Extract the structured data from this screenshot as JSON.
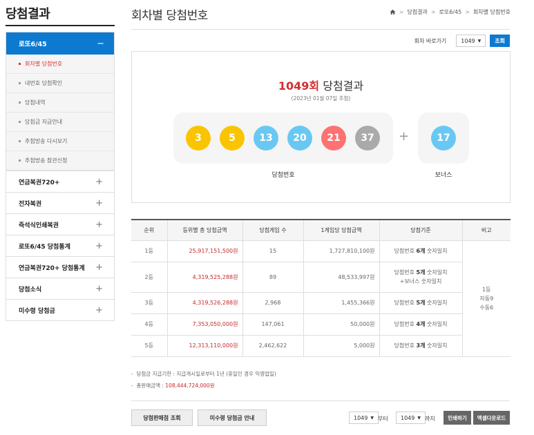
{
  "sidebar": {
    "title": "당첨결과",
    "active": {
      "label": "로또6/45",
      "symbol": "−"
    },
    "sub_items": [
      {
        "label": "회차별 당첨번호",
        "current": true
      },
      {
        "label": "내번호 당첨확인",
        "current": false
      },
      {
        "label": "당첨내역",
        "current": false
      },
      {
        "label": "당첨금 지급안내",
        "current": false
      },
      {
        "label": "추첨방송 다시보기",
        "current": false
      },
      {
        "label": "추첨방송 참관신청",
        "current": false
      }
    ],
    "items": [
      {
        "label": "연금복권720+",
        "symbol": "+"
      },
      {
        "label": "전자복권",
        "symbol": "+"
      },
      {
        "label": "즉석식인쇄복권",
        "symbol": "+"
      },
      {
        "label": "로또6/45 당첨통계",
        "symbol": "+"
      },
      {
        "label": "연금복권720+ 당첨통계",
        "symbol": "+"
      },
      {
        "label": "당첨소식",
        "symbol": "+"
      },
      {
        "label": "미수령 당첨금",
        "symbol": "+"
      }
    ]
  },
  "header": {
    "title": "회차별 당첨번호",
    "breadcrumb": [
      "당첨결과",
      "로또6/45",
      "회차별 당첨번호"
    ]
  },
  "round_jump": {
    "label": "회차 바로가기",
    "selected": "1049",
    "button": "조회"
  },
  "result": {
    "round_number": "1049회",
    "title_suffix": "당첨결과",
    "date": "(2023년 01월 07일 추첨)",
    "numbers": [
      {
        "value": "3",
        "color": "#fbc400"
      },
      {
        "value": "5",
        "color": "#fbc400"
      },
      {
        "value": "13",
        "color": "#69c8f2"
      },
      {
        "value": "20",
        "color": "#69c8f2"
      },
      {
        "value": "21",
        "color": "#ff7272"
      },
      {
        "value": "37",
        "color": "#aaaaaa"
      }
    ],
    "plus": "+",
    "bonus": {
      "value": "17",
      "color": "#69c8f2"
    },
    "win_caption": "당첨번호",
    "bonus_caption": "보너스"
  },
  "prize_table": {
    "headers": [
      "순위",
      "등위별 총 당첨금액",
      "당첨게임 수",
      "1게임당 당첨금액",
      "당첨기준",
      "비고"
    ],
    "rows": [
      {
        "rank": "1등",
        "total": "25,917,151,500원",
        "games": "15",
        "per_game": "1,727,810,100원",
        "criteria_pre": "당첨번호 ",
        "criteria_bold": "6개",
        "criteria_post": " 숫자일치",
        "criteria_line2": ""
      },
      {
        "rank": "2등",
        "total": "4,319,525,288원",
        "games": "89",
        "per_game": "48,533,997원",
        "criteria_pre": "당첨번호 ",
        "criteria_bold": "5개",
        "criteria_post": " 숫자일치",
        "criteria_line2": "+보너스 숫자일치"
      },
      {
        "rank": "3등",
        "total": "4,319,526,288원",
        "games": "2,968",
        "per_game": "1,455,366원",
        "criteria_pre": "당첨번호 ",
        "criteria_bold": "5개",
        "criteria_post": " 숫자일치",
        "criteria_line2": ""
      },
      {
        "rank": "4등",
        "total": "7,353,050,000원",
        "games": "147,061",
        "per_game": "50,000원",
        "criteria_pre": "당첨번호 ",
        "criteria_bold": "4개",
        "criteria_post": " 숫자일치",
        "criteria_line2": ""
      },
      {
        "rank": "5등",
        "total": "12,313,110,000원",
        "games": "2,462,622",
        "per_game": "5,000원",
        "criteria_pre": "당첨번호 ",
        "criteria_bold": "3개",
        "criteria_post": " 숫자일치",
        "criteria_line2": ""
      }
    ],
    "remark": [
      "1등",
      "자동9",
      "수동6"
    ]
  },
  "notes": {
    "line1": "당첨금 지급기한 : 지급개시일로부터 1년 (휴일인 경우 익영업일)",
    "line2_label": "총판매금액 : ",
    "line2_value": "108,444,724,000원"
  },
  "bottom": {
    "store_button": "당첨판매점 조회",
    "unclaimed_button": "미수령 당첨금 안내",
    "from_value": "1049",
    "from_label": "부터",
    "to_value": "1049",
    "to_label": "까지",
    "print_button": "인쇄하기",
    "excel_button": "엑셀다운로드"
  }
}
